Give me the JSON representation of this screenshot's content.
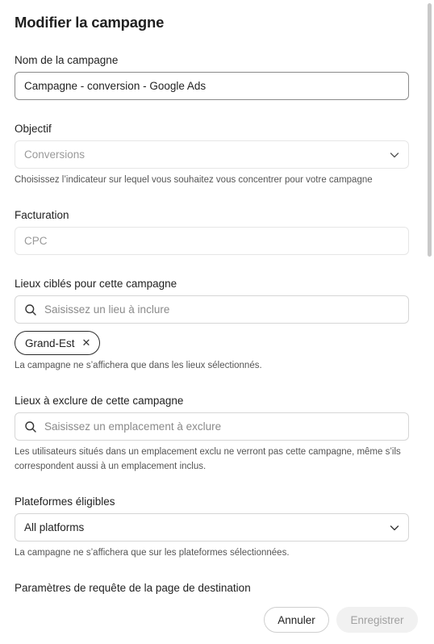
{
  "dialog": {
    "title": "Modifier la campagne"
  },
  "campaign_name": {
    "label": "Nom de la campagne",
    "value": "Campagne - conversion - Google Ads"
  },
  "objective": {
    "label": "Objectif",
    "value": "Conversions",
    "help": "Choisissez l’indicateur sur lequel vous souhaitez vous concentrer pour votre campagne"
  },
  "billing": {
    "label": "Facturation",
    "value": "CPC"
  },
  "include_locations": {
    "label": "Lieux ciblés pour cette campagne",
    "placeholder": "Saisissez un lieu à inclure",
    "chips": [
      "Grand-Est"
    ],
    "chip_remove": "✕",
    "help": "La campagne ne s’affichera que dans les lieux sélectionnés."
  },
  "exclude_locations": {
    "label": "Lieux à exclure de cette campagne",
    "placeholder": "Saisissez un emplacement à exclure",
    "help": "Les utilisateurs situés dans un emplacement exclu ne verront pas cette campagne, même s’ils correspondent aussi à un emplacement inclus."
  },
  "platforms": {
    "label": "Plateformes éligibles",
    "value": "All platforms",
    "help": "La campagne ne s’affichera que sur les plateformes sélectionnées."
  },
  "landing_params": {
    "label": "Paramètres de requête de la page de destination"
  },
  "footer": {
    "cancel_label": "Annuler",
    "save_label": "Enregistrer"
  },
  "icons": {
    "search": "search-icon",
    "chevron": "chevron-down-icon",
    "close": "close-icon"
  },
  "colors": {
    "text": "#1f1f1f",
    "muted": "#8a8a8a",
    "border": "#d6d6d6",
    "disabled_button_bg": "#f1f1f1"
  }
}
